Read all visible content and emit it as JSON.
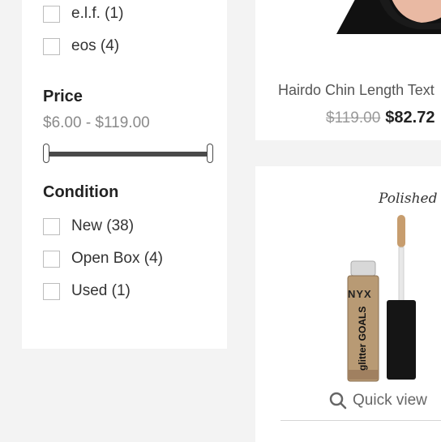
{
  "filters": {
    "brand_items": [
      {
        "label": "e.l.f. (1)"
      },
      {
        "label": "eos (4)"
      }
    ],
    "price": {
      "heading": "Price",
      "range_label": "$6.00 - $119.00",
      "min": 6,
      "max": 119
    },
    "condition": {
      "heading": "Condition",
      "items": [
        {
          "label": "New (38)"
        },
        {
          "label": "Open Box (4)"
        },
        {
          "label": "Used (1)"
        }
      ]
    }
  },
  "products": [
    {
      "name": "Hairdo Chin Length Text",
      "old_price": "$119.00",
      "price": "$82.72"
    },
    {
      "image_text_top": "Polished P",
      "brand_mark": "NYX",
      "image_text_tube": "glitter GOALS",
      "quick_view_label": "Quick view"
    }
  ],
  "colors": {
    "accent": "#2b2b2b",
    "page_bg": "#f3f3f3"
  }
}
